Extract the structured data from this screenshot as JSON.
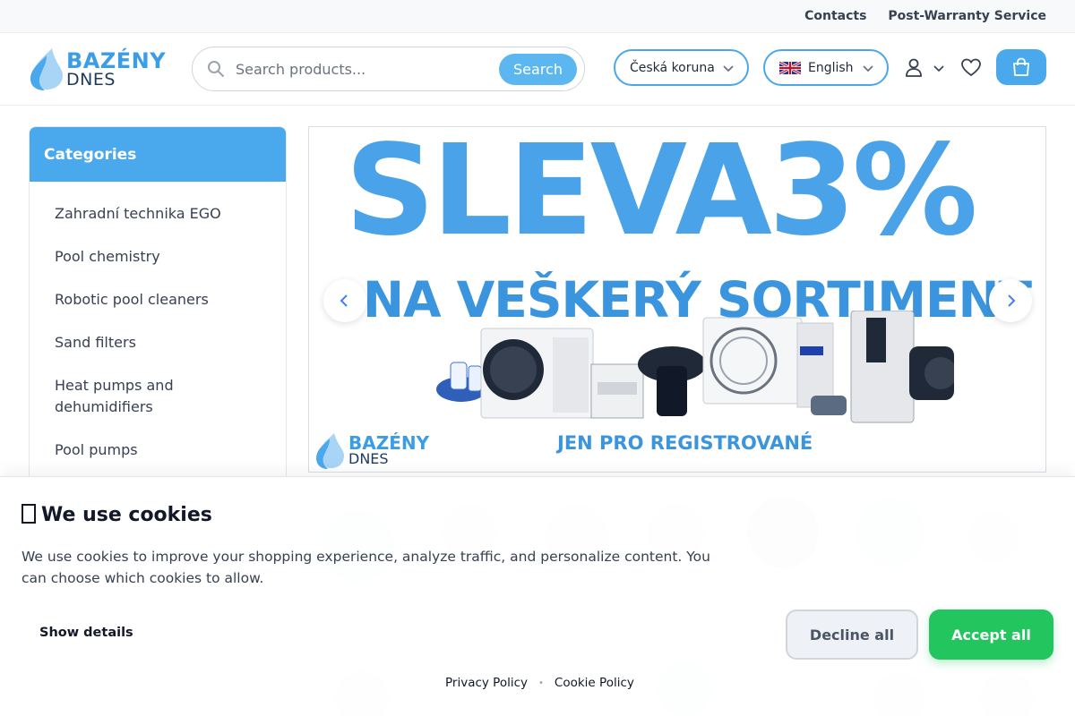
{
  "topbar": {
    "contacts": "Contacts",
    "post_warranty": "Post-Warranty Service"
  },
  "logo": {
    "line1": "BAZÉNY",
    "line2": "DNES"
  },
  "search": {
    "placeholder": "Search products...",
    "button": "Search"
  },
  "currency": {
    "selected": "Česká koruna"
  },
  "language": {
    "selected": "English"
  },
  "icons": {
    "user": "user-icon",
    "wishlist": "heart-icon",
    "cart": "shopping-bag-icon",
    "search": "search-icon"
  },
  "sidebar": {
    "title": "Categories",
    "items": [
      {
        "label": "Zahradní technika EGO"
      },
      {
        "label": "Pool chemistry"
      },
      {
        "label": "Robotic pool cleaners"
      },
      {
        "label": "Sand filters"
      },
      {
        "label": "Heat pumps and dehumidifiers"
      },
      {
        "label": "Pool pumps"
      }
    ]
  },
  "banner": {
    "headline": "SLEVA3%",
    "subheadline": "NA VEŠKERÝ SORTIMENT",
    "footnote": "JEN PRO REGISTROVANÉ",
    "logo_line1": "BAZÉNY",
    "logo_line2": "DNES"
  },
  "cookie": {
    "icon": "cookie-icon",
    "title": "We use cookies",
    "text": "We use cookies to improve your shopping experience, analyze traffic, and personalize content. You can choose which cookies to allow.",
    "show_details": "Show details",
    "decline": "Decline all",
    "accept": "Accept all",
    "privacy": "Privacy Policy",
    "cookie_policy": "Cookie Policy",
    "separator": "•"
  },
  "colors": {
    "accent": "#4aa8ed",
    "accept": "#22c55e",
    "brand_dark": "#1e3a5f"
  }
}
